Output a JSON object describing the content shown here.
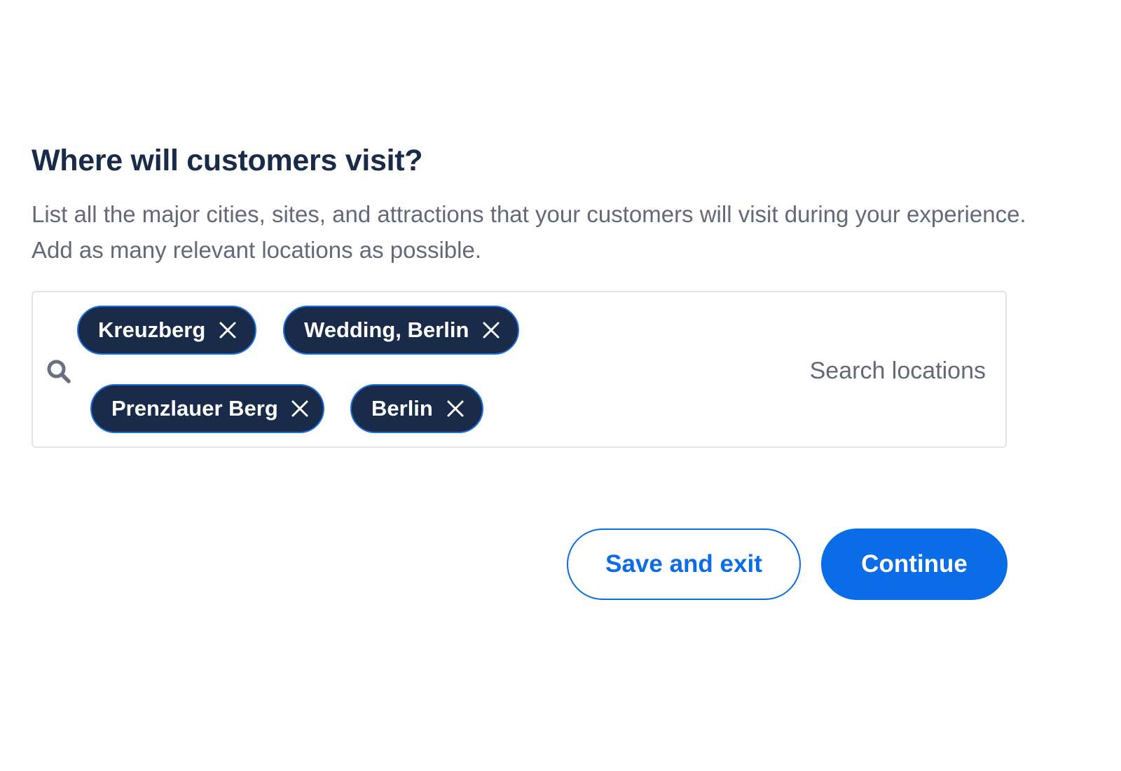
{
  "heading": "Where will customers visit?",
  "description": "List all the major cities, sites, and attractions that your customers will visit during your experience. Add as many relevant locations as possible.",
  "search": {
    "icon": "search-icon",
    "placeholder": "Search locations",
    "value": ""
  },
  "chips": [
    {
      "label": "Kreuzberg"
    },
    {
      "label": "Wedding, Berlin"
    },
    {
      "label": "Prenzlauer Berg"
    },
    {
      "label": "Berlin"
    }
  ],
  "actions": {
    "save_label": "Save and exit",
    "continue_label": "Continue"
  },
  "colors": {
    "heading": "#1a2b49",
    "body_text": "#63687a",
    "chip_bg": "#1a2b49",
    "chip_border": "#1f6fe0",
    "primary": "#0a6ce6",
    "input_border": "#e2e4ea"
  }
}
